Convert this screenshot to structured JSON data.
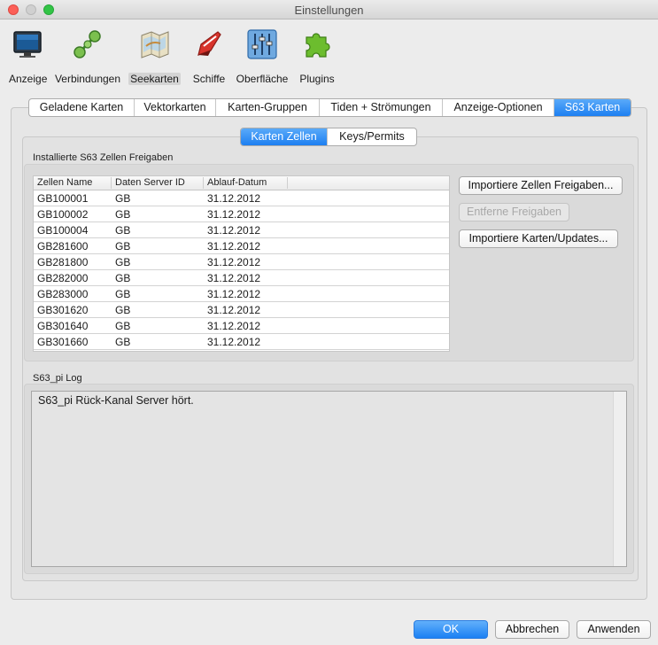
{
  "window": {
    "title": "Einstellungen"
  },
  "toolbar": [
    {
      "label": "Anzeige",
      "icon": "monitor-icon"
    },
    {
      "label": "Verbindungen",
      "icon": "connections-icon"
    },
    {
      "label": "Seekarten",
      "icon": "charts-map-icon",
      "selected": true
    },
    {
      "label": "Schiffe",
      "icon": "ship-icon"
    },
    {
      "label": "Oberfläche",
      "icon": "sliders-icon"
    },
    {
      "label": "Plugins",
      "icon": "puzzle-icon"
    }
  ],
  "tabs": [
    "Geladene Karten",
    "Vektorkarten",
    "Karten-Gruppen",
    "Tiden + Strömungen",
    "Anzeige-Optionen",
    "S63 Karten"
  ],
  "active_tab": "S63 Karten",
  "subtabs": [
    "Karten Zellen",
    "Keys/Permits"
  ],
  "active_subtab": "Karten Zellen",
  "installed": {
    "group_label": "Installierte S63 Zellen Freigaben",
    "columns": [
      "Zellen Name",
      "Daten Server ID",
      "Ablauf-Datum"
    ],
    "rows": [
      [
        "GB100001",
        "GB",
        "31.12.2012"
      ],
      [
        "GB100002",
        "GB",
        "31.12.2012"
      ],
      [
        "GB100004",
        "GB",
        "31.12.2012"
      ],
      [
        "GB281600",
        "GB",
        "31.12.2012"
      ],
      [
        "GB281800",
        "GB",
        "31.12.2012"
      ],
      [
        "GB282000",
        "GB",
        "31.12.2012"
      ],
      [
        "GB283000",
        "GB",
        "31.12.2012"
      ],
      [
        "GB301620",
        "GB",
        "31.12.2012"
      ],
      [
        "GB301640",
        "GB",
        "31.12.2012"
      ],
      [
        "GB301660",
        "GB",
        "31.12.2012"
      ]
    ],
    "buttons": {
      "import_permits": "Importiere Zellen Freigaben...",
      "remove_permits": "Entferne Freigaben",
      "import_charts": "Importiere Karten/Updates..."
    }
  },
  "log": {
    "group_label": "S63_pi Log",
    "text": "S63_pi Rück-Kanal Server hört."
  },
  "footer": {
    "ok": "OK",
    "cancel": "Abbrechen",
    "apply": "Anwenden"
  },
  "colors": {
    "accent": "#1d7ff1",
    "close": "#fc5f57",
    "maximize": "#32c446"
  }
}
